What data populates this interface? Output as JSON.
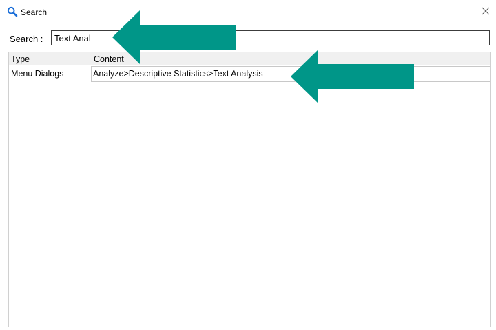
{
  "window": {
    "title": "Search",
    "close_glyph": "✕"
  },
  "search": {
    "label": "Search :",
    "value": "Text Anal"
  },
  "results": {
    "columns": [
      "Type",
      "Content"
    ],
    "rows": [
      {
        "type": "Menu Dialogs",
        "content": "Analyze>Descriptive Statistics>Text Analysis"
      }
    ]
  },
  "annotations": {
    "arrow_color": "#009688"
  },
  "icons": {
    "title": "search-icon",
    "close": "close-icon"
  }
}
